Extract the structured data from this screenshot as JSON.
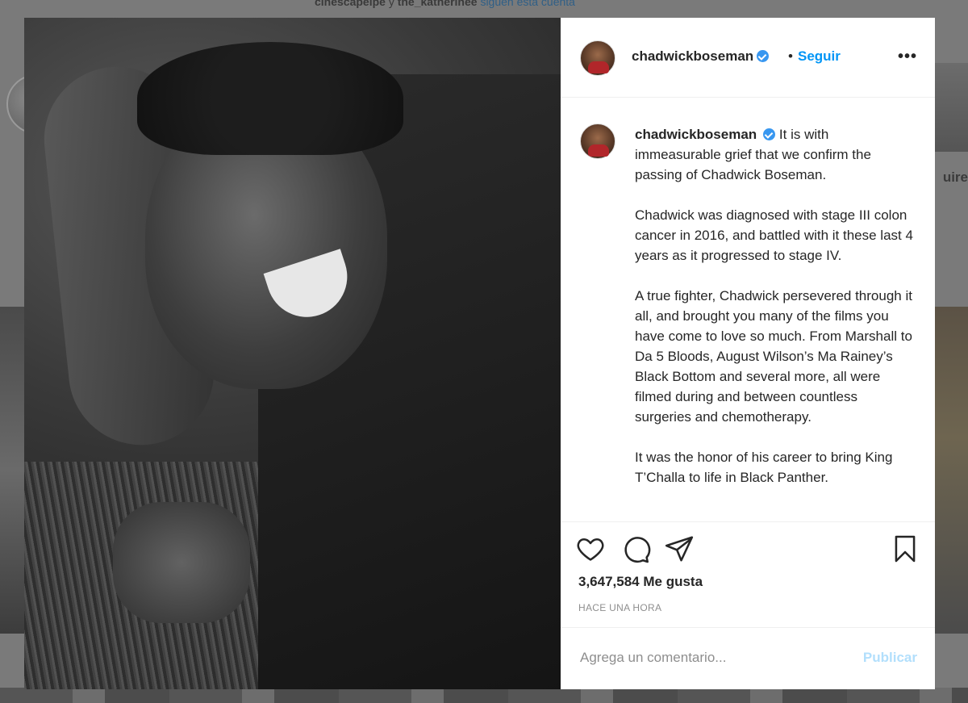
{
  "background": {
    "top_line": {
      "user1": "cinescapelpe",
      "connector": "y",
      "user2": "the_katherinee",
      "suffix": "siguen esta cuenta"
    },
    "right_text": "uire"
  },
  "post": {
    "header": {
      "username": "chadwickboseman",
      "separator": "•",
      "follow_label": "Seguir",
      "more_label": "•••"
    },
    "caption": {
      "username": "chadwickboseman",
      "paragraphs": [
        "It is with immeasurable grief that we confirm the passing of Chadwick Boseman.",
        "Chadwick was diagnosed with stage III colon cancer in 2016, and battled with it these last 4 years as it progressed to stage IV.",
        "A true fighter, Chadwick persevered through it all, and brought you many of the films you have come to love so much. From Marshall to Da 5 Bloods, August Wilson’s Ma Rainey’s Black Bottom and several more, all were filmed during and between countless surgeries and chemotherapy.",
        "It was the honor of his career to bring King T’Challa to life in Black Panther."
      ]
    },
    "likes_text": "3,647,584 Me gusta",
    "time_text": "HACE UNA HORA",
    "comment": {
      "placeholder": "Agrega un comentario...",
      "value": "",
      "publish_label": "Publicar"
    }
  }
}
